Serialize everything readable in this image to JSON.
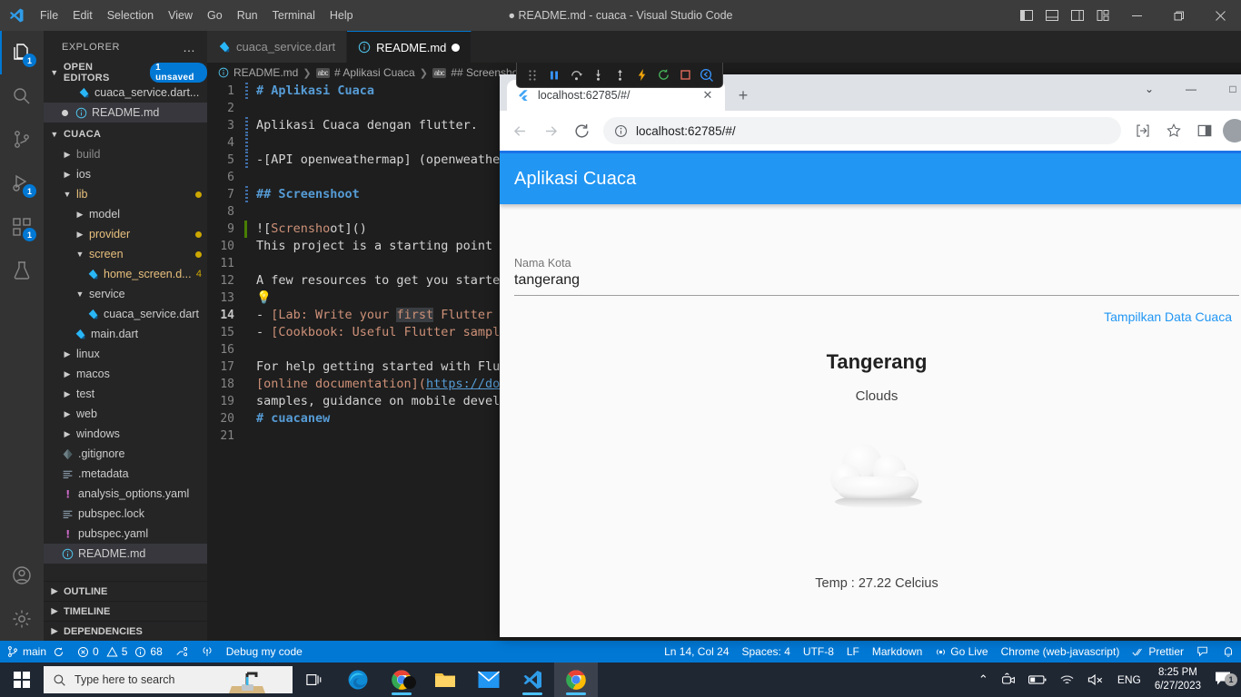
{
  "vscode": {
    "window_title": "● README.md - cuaca - Visual Studio Code",
    "menus": [
      "File",
      "Edit",
      "Selection",
      "View",
      "Go",
      "Run",
      "Terminal",
      "Help"
    ],
    "activity_items": [
      {
        "name": "explorer",
        "icon": "files-icon",
        "badge": "1",
        "active": true
      },
      {
        "name": "search",
        "icon": "search-icon",
        "badge": "",
        "active": false
      },
      {
        "name": "source-control",
        "icon": "source-control-icon",
        "badge": "",
        "active": false
      },
      {
        "name": "run-debug",
        "icon": "run-debug-icon",
        "badge": "1",
        "active": false
      },
      {
        "name": "extensions",
        "icon": "extensions-icon",
        "badge": "1",
        "active": false
      },
      {
        "name": "testing",
        "icon": "beaker-icon",
        "badge": "",
        "active": false
      }
    ],
    "activity_bottom": [
      {
        "name": "accounts",
        "icon": "account-icon"
      },
      {
        "name": "settings",
        "icon": "gear-icon"
      }
    ],
    "sidebar": {
      "header": "EXPLORER",
      "open_editors": {
        "label": "OPEN EDITORS",
        "badge": "1 unsaved",
        "items": [
          {
            "label": "cuaca_service.dart...",
            "icon": "dart-icon",
            "modified": false
          },
          {
            "label": "README.md",
            "icon": "info-icon",
            "modified": true,
            "selected": true
          }
        ]
      },
      "project": {
        "label": "CUACA",
        "tree": [
          {
            "label": "build",
            "type": "folder",
            "expanded": false,
            "depth": 1,
            "dim": true
          },
          {
            "label": "ios",
            "type": "folder",
            "expanded": false,
            "depth": 1,
            "dim": false
          },
          {
            "label": "lib",
            "type": "folder",
            "expanded": true,
            "depth": 1,
            "highlight": true,
            "dirty": true
          },
          {
            "label": "model",
            "type": "folder",
            "expanded": false,
            "depth": 2,
            "dim": false
          },
          {
            "label": "provider",
            "type": "folder",
            "expanded": false,
            "depth": 2,
            "highlight": true,
            "dirty": true
          },
          {
            "label": "screen",
            "type": "folder",
            "expanded": true,
            "depth": 2,
            "highlight": true,
            "dirty": true
          },
          {
            "label": "home_screen.d...",
            "type": "dart",
            "depth": 3,
            "highlight": true,
            "errors": "4"
          },
          {
            "label": "service",
            "type": "folder",
            "expanded": true,
            "depth": 2,
            "dim": false
          },
          {
            "label": "cuaca_service.dart",
            "type": "dart",
            "depth": 3,
            "dim": false
          },
          {
            "label": "main.dart",
            "type": "dart",
            "depth": 2,
            "dim": false
          },
          {
            "label": "linux",
            "type": "folder",
            "expanded": false,
            "depth": 1,
            "dim": false
          },
          {
            "label": "macos",
            "type": "folder",
            "expanded": false,
            "depth": 1,
            "dim": false
          },
          {
            "label": "test",
            "type": "folder",
            "expanded": false,
            "depth": 1,
            "dim": false
          },
          {
            "label": "web",
            "type": "folder",
            "expanded": false,
            "depth": 1,
            "dim": false
          },
          {
            "label": "windows",
            "type": "folder",
            "expanded": false,
            "depth": 1,
            "dim": false
          },
          {
            "label": ".gitignore",
            "type": "git",
            "depth": 1,
            "dim": false
          },
          {
            "label": ".metadata",
            "type": "lines",
            "depth": 1,
            "dim": false
          },
          {
            "label": "analysis_options.yaml",
            "type": "yaml",
            "depth": 1,
            "dim": false
          },
          {
            "label": "pubspec.lock",
            "type": "lines",
            "depth": 1,
            "dim": false
          },
          {
            "label": "pubspec.yaml",
            "type": "yaml",
            "depth": 1,
            "dim": false
          },
          {
            "label": "README.md",
            "type": "info",
            "depth": 1,
            "selected": true
          }
        ]
      },
      "panels": [
        "OUTLINE",
        "TIMELINE",
        "DEPENDENCIES"
      ]
    },
    "tabs": [
      {
        "label": "cuaca_service.dart",
        "icon": "dart-icon",
        "active": false,
        "modified": false
      },
      {
        "label": "README.md",
        "icon": "info-icon",
        "active": true,
        "modified": true
      }
    ],
    "breadcrumb": [
      "README.md",
      "# Aplikasi Cuaca",
      "## Screenshoot"
    ],
    "debug_toolbar": [
      "drag-handle",
      "pause",
      "step-over",
      "step-into",
      "step-out",
      "hot-reload",
      "restart",
      "stop",
      "inspector"
    ],
    "code_lines": [
      {
        "n": "1",
        "text": "# Aplikasi Cuaca",
        "style": "heading",
        "fold": true
      },
      {
        "n": "2",
        "text": "",
        "style": "plain"
      },
      {
        "n": "3",
        "text": "Aplikasi Cuaca dengan flutter.",
        "style": "plain",
        "fold": true
      },
      {
        "n": "4",
        "text": "",
        "style": "plain",
        "fold": true
      },
      {
        "n": "5",
        "text": "-[API openweathermap] (openweathe",
        "style": "plain",
        "fold": true
      },
      {
        "n": "6",
        "text": "",
        "style": "plain"
      },
      {
        "n": "7",
        "text": "## Screenshoot",
        "style": "heading",
        "fold": true
      },
      {
        "n": "8",
        "text": "",
        "style": "plain"
      },
      {
        "n": "9",
        "text": "![Scrensho ot]()",
        "style": "imglink",
        "added": true
      },
      {
        "n": "10",
        "text": "This project is a starting point",
        "style": "plain"
      },
      {
        "n": "11",
        "text": "",
        "style": "plain"
      },
      {
        "n": "12",
        "text": "A few resources to get you starte",
        "style": "plain"
      },
      {
        "n": "13",
        "text": "💡",
        "style": "plain"
      },
      {
        "n": "14",
        "text": "- [Lab: Write your first Flutter",
        "style": "linkline",
        "current": true
      },
      {
        "n": "15",
        "text": "- [Cookbook: Useful Flutter sampl",
        "style": "linkline"
      },
      {
        "n": "16",
        "text": "",
        "style": "plain"
      },
      {
        "n": "17",
        "text": "For help getting started with Flu",
        "style": "plain"
      },
      {
        "n": "18",
        "text": "[online documentation](https://do",
        "style": "urlline"
      },
      {
        "n": "19",
        "text": "samples, guidance on mobile devel",
        "style": "plain"
      },
      {
        "n": "20",
        "text": "# cuacanew",
        "style": "heading"
      },
      {
        "n": "21",
        "text": "",
        "style": "plain"
      }
    ],
    "statusbar": {
      "branch": "main",
      "sync_icon": "sync-icon",
      "errors": "0",
      "warnings": "5",
      "infos": "68",
      "ports_icon": "ports-icon",
      "radio_icon": "radio-tower-icon",
      "debug_label": "Debug my code",
      "cursor": "Ln 14, Col 24",
      "spaces": "Spaces: 4",
      "encoding": "UTF-8",
      "eol": "LF",
      "language": "Markdown",
      "golive": "Go Live",
      "browser": "Chrome (web-javascript)",
      "prettier": "Prettier",
      "feedback_icon": "feedback-icon",
      "bell_icon": "bell-icon"
    }
  },
  "chrome": {
    "tab": {
      "title": "localhost:62785/#/",
      "favicon": "flutter-icon"
    },
    "new_tab_label": "+",
    "window_controls": {
      "minimize_chevron": "⌄",
      "minimize": "—",
      "maximize": "□"
    },
    "nav": {
      "back": "←",
      "forward": "→",
      "reload": "⟳"
    },
    "omnibox": {
      "info_icon": "info-circle-icon",
      "url": "localhost:62785/#/"
    },
    "actions": {
      "share": "share-icon",
      "bookmark": "star-icon",
      "sidepanel": "side-panel-icon",
      "profile": "avatar"
    }
  },
  "app": {
    "title": "Aplikasi Cuaca",
    "field": {
      "label": "Nama Kota",
      "value": "tangerang"
    },
    "submit_label": "Tampilkan Data Cuaca",
    "result": {
      "city": "Tangerang",
      "condition": "Clouds",
      "icon": "cloud-icon",
      "temperature": "Temp : 27.22 Celcius"
    }
  },
  "taskbar": {
    "start_icon": "windows-start-icon",
    "search_placeholder": "Type here to search",
    "search_icon": "search-icon",
    "items": [
      {
        "name": "task-view",
        "icon": "task-view-icon",
        "running": false,
        "active": false
      },
      {
        "name": "microsoft-edge",
        "icon": "edge-icon",
        "running": false,
        "active": false
      },
      {
        "name": "chrome-beta",
        "icon": "chrome-icon",
        "running": true,
        "active": false
      },
      {
        "name": "file-explorer",
        "icon": "folder-icon",
        "running": false,
        "active": false
      },
      {
        "name": "mail",
        "icon": "mail-icon",
        "running": false,
        "active": false
      },
      {
        "name": "visual-studio-code",
        "icon": "vscode-icon",
        "running": true,
        "active": false
      },
      {
        "name": "google-chrome",
        "icon": "chrome-icon",
        "running": true,
        "active": true
      }
    ],
    "tray": {
      "chevron": "⌃",
      "meet_icon": "camera-icon",
      "battery_icon": "battery-icon",
      "network_icon": "wifi-icon",
      "volume_icon": "speaker-muted-icon",
      "language": "ENG",
      "time": "8:25 PM",
      "date": "6/27/2023",
      "notification_icon": "notification-icon",
      "notification_count": "1"
    }
  },
  "colors": {
    "accent_blue": "#0078d4",
    "flutter_blue": "#2196f3",
    "taskbar": "#1f2733",
    "editor_bg": "#1e1e1e"
  }
}
